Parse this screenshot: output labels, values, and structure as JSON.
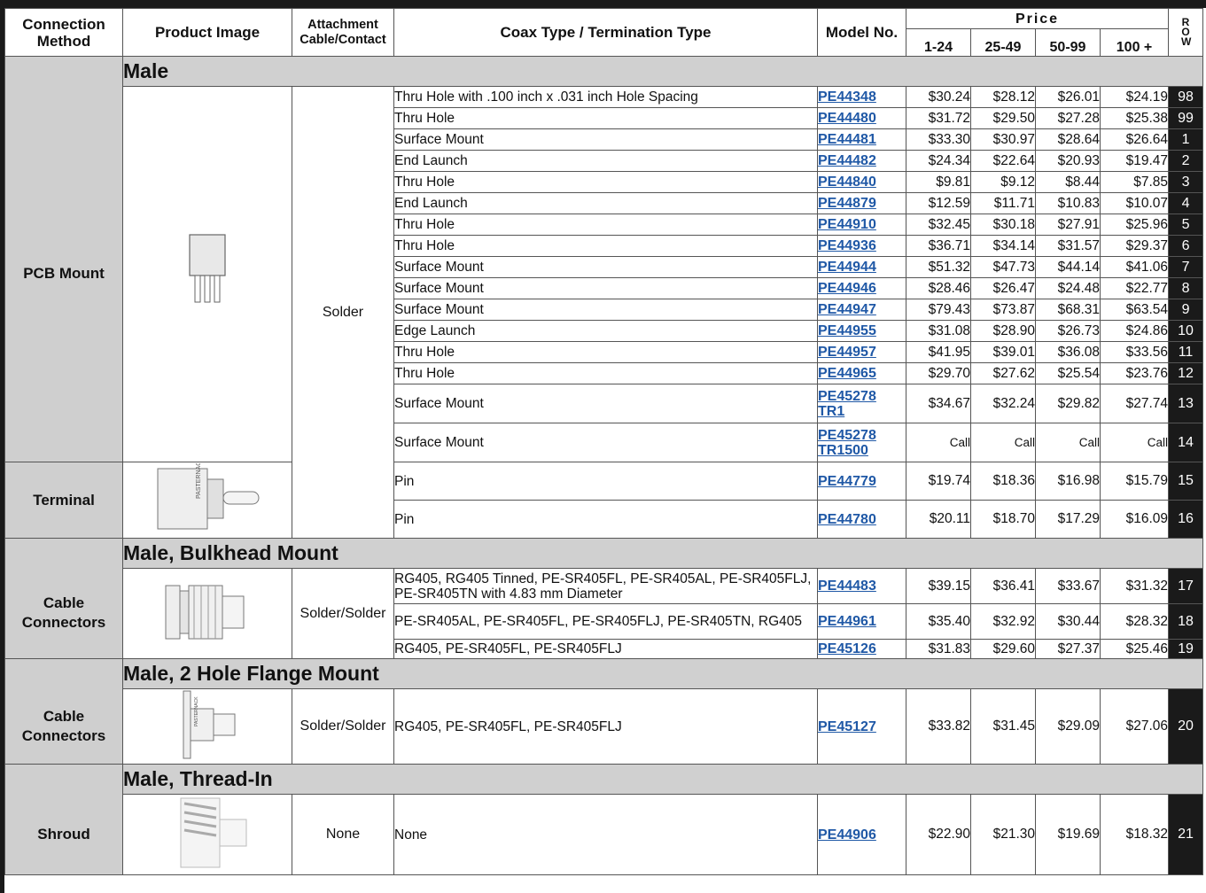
{
  "headers": {
    "method": "Connection Method",
    "image": "Product Image",
    "attach": "Attachment Cable/Contact",
    "coax": "Coax Type / Termination Type",
    "model": "Model No.",
    "price": "Price",
    "row": "R O W",
    "qty": [
      "1-24",
      "25-49",
      "50-99",
      "100 +"
    ]
  },
  "sections": [
    {
      "title": "Male",
      "groups": [
        {
          "method": "PCB Mount",
          "image": "pcb-connector-icon",
          "rows": [
            {
              "desc": "Thru Hole with .100 inch x .031 inch Hole Spacing",
              "model": "PE44348",
              "prices": [
                "$30.24",
                "$28.12",
                "$26.01",
                "$24.19"
              ],
              "row": "98"
            },
            {
              "desc": "Thru Hole",
              "model": "PE44480",
              "prices": [
                "$31.72",
                "$29.50",
                "$27.28",
                "$25.38"
              ],
              "row": "99"
            },
            {
              "desc": "Surface Mount",
              "model": "PE44481",
              "prices": [
                "$33.30",
                "$30.97",
                "$28.64",
                "$26.64"
              ],
              "row": "1"
            },
            {
              "desc": "End Launch",
              "model": "PE44482",
              "prices": [
                "$24.34",
                "$22.64",
                "$20.93",
                "$19.47"
              ],
              "row": "2"
            },
            {
              "desc": "Thru Hole",
              "model": "PE44840",
              "prices": [
                "$9.81",
                "$9.12",
                "$8.44",
                "$7.85"
              ],
              "row": "3"
            },
            {
              "desc": "End Launch",
              "model": "PE44879",
              "prices": [
                "$12.59",
                "$11.71",
                "$10.83",
                "$10.07"
              ],
              "row": "4"
            },
            {
              "desc": "Thru Hole",
              "model": "PE44910",
              "prices": [
                "$32.45",
                "$30.18",
                "$27.91",
                "$25.96"
              ],
              "row": "5"
            },
            {
              "desc": "Thru Hole",
              "model": "PE44936",
              "prices": [
                "$36.71",
                "$34.14",
                "$31.57",
                "$29.37"
              ],
              "row": "6"
            },
            {
              "desc": "Surface Mount",
              "model": "PE44944",
              "prices": [
                "$51.32",
                "$47.73",
                "$44.14",
                "$41.06"
              ],
              "row": "7"
            },
            {
              "desc": "Surface Mount",
              "model": "PE44946",
              "prices": [
                "$28.46",
                "$26.47",
                "$24.48",
                "$22.77"
              ],
              "row": "8"
            },
            {
              "desc": "Surface Mount",
              "model": "PE44947",
              "prices": [
                "$79.43",
                "$73.87",
                "$68.31",
                "$63.54"
              ],
              "row": "9"
            },
            {
              "desc": "Edge Launch",
              "model": "PE44955",
              "prices": [
                "$31.08",
                "$28.90",
                "$26.73",
                "$24.86"
              ],
              "row": "10"
            },
            {
              "desc": "Thru Hole",
              "model": "PE44957",
              "prices": [
                "$41.95",
                "$39.01",
                "$36.08",
                "$33.56"
              ],
              "row": "11"
            },
            {
              "desc": "Thru Hole",
              "model": "PE44965",
              "prices": [
                "$29.70",
                "$27.62",
                "$25.54",
                "$23.76"
              ],
              "row": "12"
            },
            {
              "desc": "Surface Mount",
              "model": "PE45278 TR1",
              "prices": [
                "$34.67",
                "$32.24",
                "$29.82",
                "$27.74"
              ],
              "row": "13"
            },
            {
              "desc": "Surface Mount",
              "model": "PE45278 TR1500",
              "prices": [
                "Call",
                "Call",
                "Call",
                "Call"
              ],
              "row": "14"
            }
          ]
        },
        {
          "method": "Terminal",
          "image": "terminal-connector-icon",
          "image_text": "PASTERNACK",
          "rows": [
            {
              "desc": "Pin",
              "model": "PE44779",
              "prices": [
                "$19.74",
                "$18.36",
                "$16.98",
                "$15.79"
              ],
              "row": "15"
            },
            {
              "desc": "Pin",
              "model": "PE44780",
              "prices": [
                "$20.11",
                "$18.70",
                "$17.29",
                "$16.09"
              ],
              "row": "16"
            }
          ]
        }
      ],
      "attach": "Solder"
    },
    {
      "title": "Male, Bulkhead Mount",
      "method": "Cable Connectors",
      "image": "bulkhead-connector-icon",
      "attach": "Solder/Solder",
      "rows": [
        {
          "desc": "RG405, RG405 Tinned, PE-SR405FL, PE-SR405AL, PE-SR405FLJ, PE-SR405TN with 4.83 mm Diameter",
          "model": "PE44483",
          "prices": [
            "$39.15",
            "$36.41",
            "$33.67",
            "$31.32"
          ],
          "row": "17"
        },
        {
          "desc": "PE-SR405AL, PE-SR405FL, PE-SR405FLJ, PE-SR405TN, RG405",
          "model": "PE44961",
          "prices": [
            "$35.40",
            "$32.92",
            "$30.44",
            "$28.32"
          ],
          "row": "18"
        },
        {
          "desc": "RG405, PE-SR405FL, PE-SR405FLJ",
          "model": "PE45126",
          "prices": [
            "$31.83",
            "$29.60",
            "$27.37",
            "$25.46"
          ],
          "row": "19"
        }
      ]
    },
    {
      "title": "Male, 2 Hole Flange Mount",
      "method": "Cable Connectors",
      "image": "flange-connector-icon",
      "image_text": "PASTERNACK",
      "attach": "Solder/Solder",
      "rows": [
        {
          "desc": "RG405, PE-SR405FL, PE-SR405FLJ",
          "model": "PE45127",
          "prices": [
            "$33.82",
            "$31.45",
            "$29.09",
            "$27.06"
          ],
          "row": "20"
        }
      ]
    },
    {
      "title": "Male, Thread-In",
      "method": "Shroud",
      "image": "threaded-shroud-icon",
      "attach": "None",
      "rows": [
        {
          "desc": "None",
          "model": "PE44906",
          "prices": [
            "$22.90",
            "$21.30",
            "$19.69",
            "$18.32"
          ],
          "row": "21"
        }
      ]
    }
  ]
}
